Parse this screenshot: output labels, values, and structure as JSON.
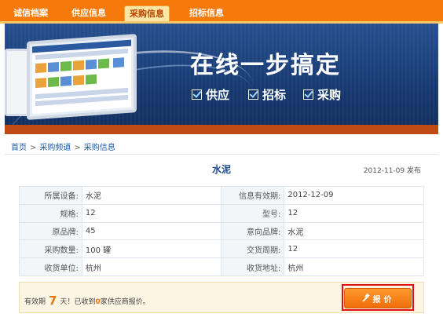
{
  "nav": {
    "items": [
      {
        "label": "诚信档案"
      },
      {
        "label": "供应信息"
      },
      {
        "label": "采购信息"
      },
      {
        "label": "招标信息"
      }
    ],
    "active_index": 2
  },
  "banner": {
    "slogan": "在线一步搞定",
    "features": [
      "供应",
      "招标",
      "采购"
    ]
  },
  "breadcrumb": {
    "items": [
      "首页",
      "采购频道",
      "采购信息"
    ],
    "separator": ">"
  },
  "detail": {
    "title": "水泥",
    "publish_date": "2012-11-09 发布"
  },
  "info_table": {
    "rows": [
      {
        "k1": "所属设备:",
        "v1": "水泥",
        "k2": "信息有效期:",
        "v2": "2012-12-09"
      },
      {
        "k1": "规格:",
        "v1": "12",
        "k2": "型号:",
        "v2": "12"
      },
      {
        "k1": "原品牌:",
        "v1": "45",
        "k2": "意向品牌:",
        "v2": "水泥"
      },
      {
        "k1": "采购数量:",
        "v1": "100 罐",
        "k2": "交货周期:",
        "v2": "12"
      },
      {
        "k1": "收货单位:",
        "v1": "杭州",
        "k2": "收货地址:",
        "v2": "杭州"
      }
    ]
  },
  "quote": {
    "prefix": "有效期",
    "days": "7",
    "middle": "天！已收到",
    "count": "0",
    "suffix": "家供应商报价。",
    "button_label": "报价"
  },
  "colors": {
    "nav_bg": "#f57a0a",
    "accent": "#e8740c",
    "link": "#1b5aa8",
    "banner": "#1b3f7d",
    "highlight": "#e01010"
  }
}
